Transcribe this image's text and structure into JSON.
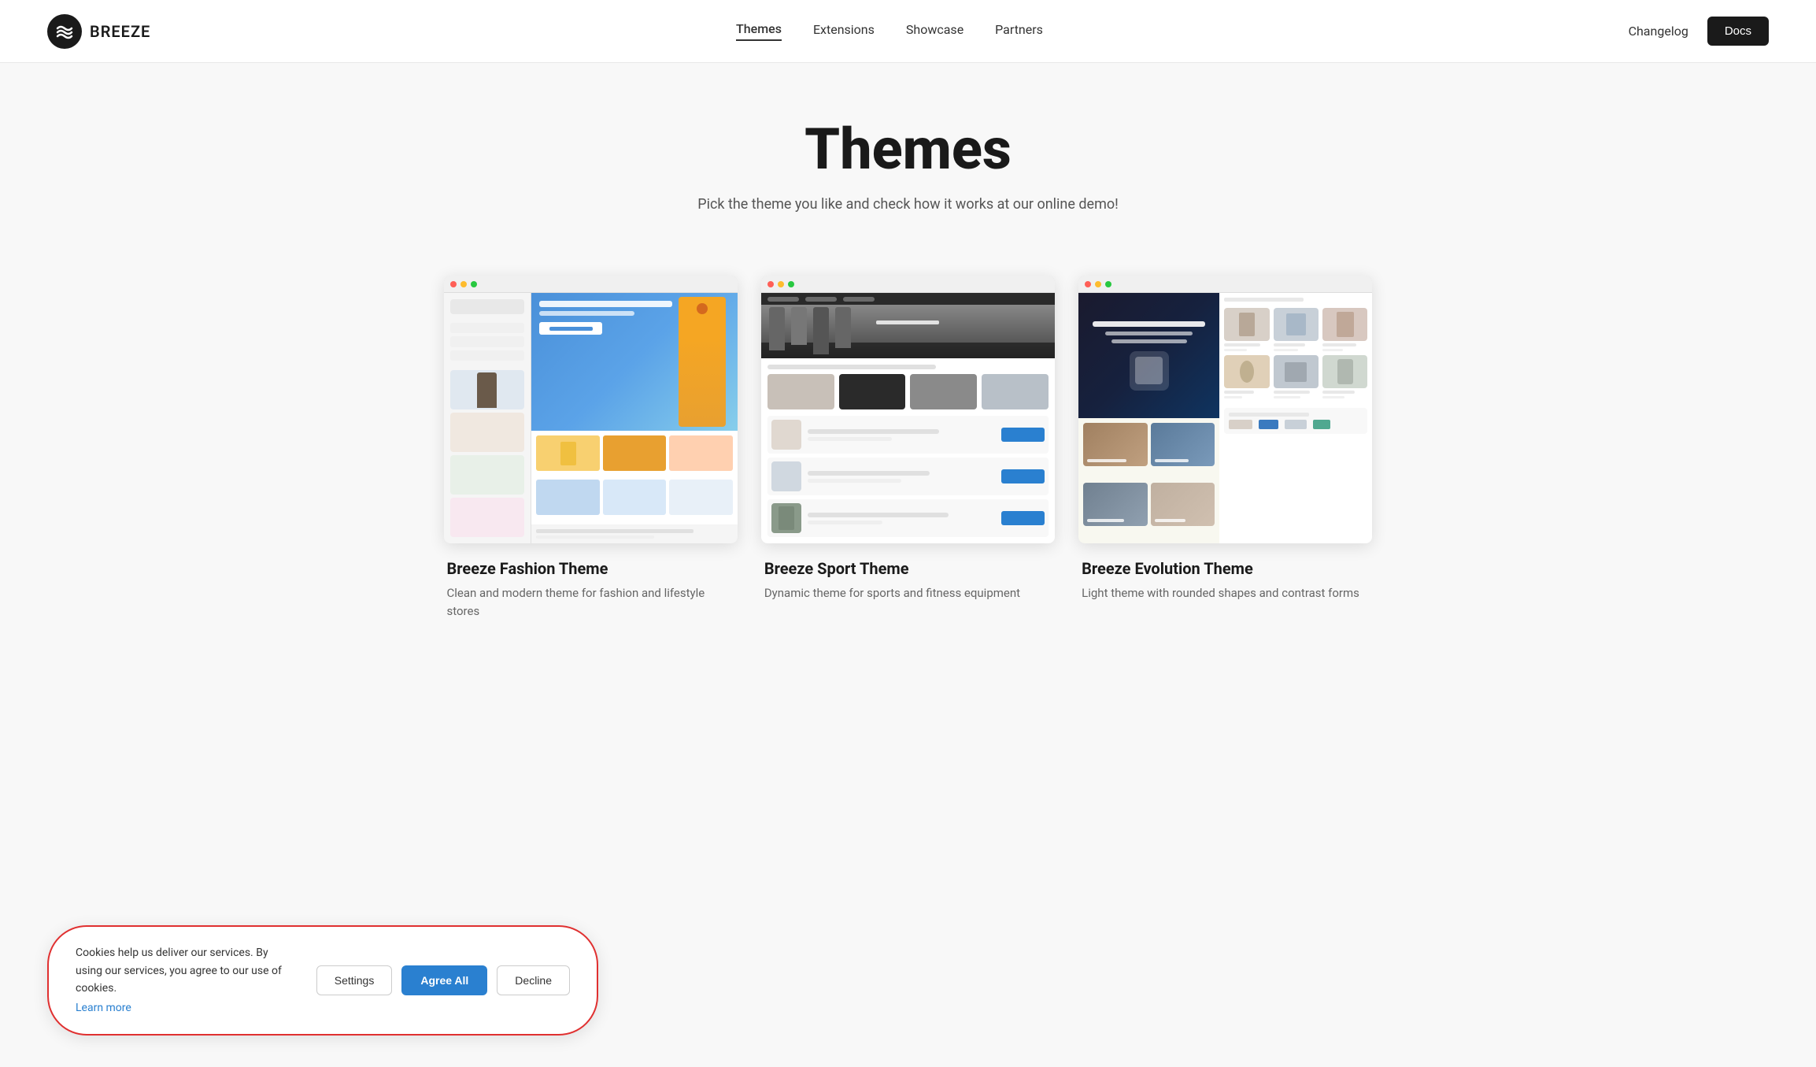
{
  "brand": {
    "name": "BREEZE"
  },
  "nav": {
    "links": [
      {
        "label": "Themes",
        "active": true
      },
      {
        "label": "Extensions",
        "active": false
      },
      {
        "label": "Showcase",
        "active": false
      },
      {
        "label": "Partners",
        "active": false
      }
    ],
    "changelog": "Changelog",
    "docs": "Docs"
  },
  "hero": {
    "title": "Themes",
    "subtitle": "Pick the theme you like and check how it works at our online demo!"
  },
  "themes": [
    {
      "name": "Breeze Fashion Theme",
      "description": "Clean and modern theme for fashion and lifestyle stores"
    },
    {
      "name": "Breeze Sport Theme",
      "description": "Dynamic theme for sports and fitness equipment"
    },
    {
      "name": "Breeze Evolution Theme",
      "description": "Light theme with rounded shapes and contrast forms"
    }
  ],
  "cookie": {
    "text": "Cookies help us deliver our services. By using our services, you agree to our use of cookies.",
    "learn_more": "Learn more",
    "settings_label": "Settings",
    "agree_label": "Agree All",
    "decline_label": "Decline"
  }
}
